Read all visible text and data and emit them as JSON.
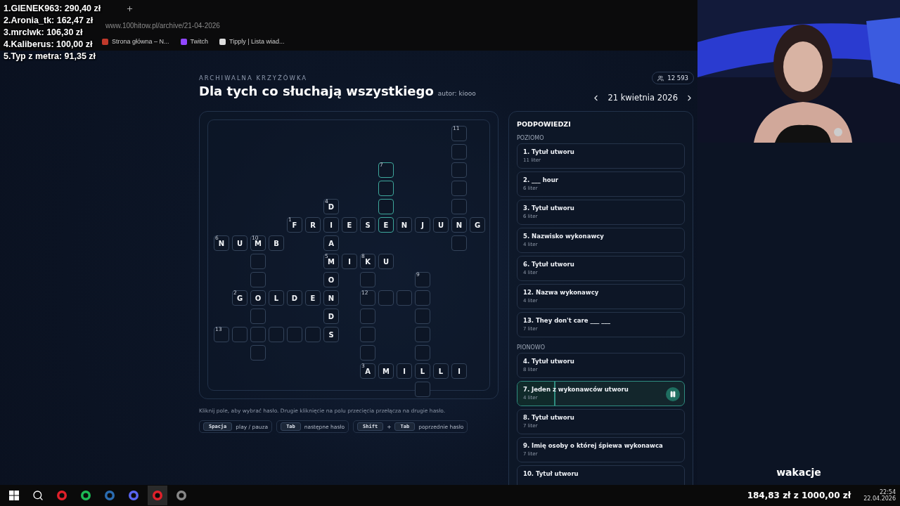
{
  "leaderboard": [
    "1.GIENEK963: 290,40 zł",
    "2.Aronia_tk: 162,47 zł",
    "3.mrclwk: 106,30 zł",
    "4.Kaliberus: 100,00 zł",
    "5.Typ z metra: 91,35 zł"
  ],
  "browser": {
    "address": "www.100hitow.pl/archive/21-04-2026",
    "bookmarks": [
      "Strona główna – N...",
      "Twitch",
      "Tipply | Lista wiad..."
    ]
  },
  "header": {
    "kicker": "ARCHIWALNA KRZYŻÓWKA",
    "title": "Dla tych co słuchają wszystkiego",
    "author": "autor: kiooo",
    "viewers": "12 593",
    "date": "21 kwietnia 2026"
  },
  "grid": [
    [
      {
        "kind": "block"
      },
      {
        "kind": "block"
      },
      {
        "kind": "block"
      },
      {
        "kind": "block"
      },
      {
        "kind": "block"
      },
      {
        "kind": "block"
      },
      {
        "kind": "block"
      },
      {
        "kind": "block"
      },
      {
        "kind": "block"
      },
      {
        "kind": "block"
      },
      {
        "kind": "block"
      },
      {
        "kind": "block"
      },
      {
        "kind": "block"
      },
      {
        "kind": "cell",
        "number": "11",
        "active": false
      },
      {
        "kind": "block"
      }
    ],
    [
      {
        "kind": "block"
      },
      {
        "kind": "block"
      },
      {
        "kind": "block"
      },
      {
        "kind": "block"
      },
      {
        "kind": "block"
      },
      {
        "kind": "block"
      },
      {
        "kind": "block"
      },
      {
        "kind": "block"
      },
      {
        "kind": "block"
      },
      {
        "kind": "block"
      },
      {
        "kind": "block"
      },
      {
        "kind": "block"
      },
      {
        "kind": "block"
      },
      {
        "kind": "cell",
        "active": false
      },
      {
        "kind": "block"
      }
    ],
    [
      {
        "kind": "block"
      },
      {
        "kind": "block"
      },
      {
        "kind": "block"
      },
      {
        "kind": "block"
      },
      {
        "kind": "block"
      },
      {
        "kind": "block"
      },
      {
        "kind": "block"
      },
      {
        "kind": "block"
      },
      {
        "kind": "block"
      },
      {
        "kind": "cell",
        "number": "7",
        "active": true
      },
      {
        "kind": "block"
      },
      {
        "kind": "block"
      },
      {
        "kind": "block"
      },
      {
        "kind": "cell",
        "active": false
      },
      {
        "kind": "block"
      }
    ],
    [
      {
        "kind": "block"
      },
      {
        "kind": "block"
      },
      {
        "kind": "block"
      },
      {
        "kind": "block"
      },
      {
        "kind": "block"
      },
      {
        "kind": "block"
      },
      {
        "kind": "block"
      },
      {
        "kind": "block"
      },
      {
        "kind": "block"
      },
      {
        "kind": "cell",
        "active": true
      },
      {
        "kind": "block"
      },
      {
        "kind": "block"
      },
      {
        "kind": "block"
      },
      {
        "kind": "cell",
        "active": false
      },
      {
        "kind": "block"
      }
    ],
    [
      {
        "kind": "block"
      },
      {
        "kind": "block"
      },
      {
        "kind": "block"
      },
      {
        "kind": "block"
      },
      {
        "kind": "block"
      },
      {
        "kind": "block"
      },
      {
        "kind": "cell",
        "letter": "D",
        "number": "4",
        "active": false
      },
      {
        "kind": "block"
      },
      {
        "kind": "block"
      },
      {
        "kind": "cell",
        "active": true
      },
      {
        "kind": "block"
      },
      {
        "kind": "block"
      },
      {
        "kind": "block"
      },
      {
        "kind": "cell",
        "active": false
      },
      {
        "kind": "block"
      }
    ],
    [
      {
        "kind": "block"
      },
      {
        "kind": "block"
      },
      {
        "kind": "block"
      },
      {
        "kind": "block"
      },
      {
        "kind": "cell",
        "letter": "F",
        "number": "1",
        "active": false
      },
      {
        "kind": "cell",
        "letter": "R",
        "active": false
      },
      {
        "kind": "cell",
        "letter": "I",
        "active": false
      },
      {
        "kind": "cell",
        "letter": "E",
        "active": false
      },
      {
        "kind": "cell",
        "letter": "S",
        "active": false
      },
      {
        "kind": "cell",
        "letter": "E",
        "active": true
      },
      {
        "kind": "cell",
        "letter": "N",
        "active": false
      },
      {
        "kind": "cell",
        "letter": "J",
        "active": false
      },
      {
        "kind": "cell",
        "letter": "U",
        "active": false
      },
      {
        "kind": "cell",
        "letter": "N",
        "active": false
      },
      {
        "kind": "cell",
        "letter": "G",
        "active": false
      }
    ],
    [
      {
        "kind": "cell",
        "letter": "N",
        "number": "6",
        "active": false
      },
      {
        "kind": "cell",
        "letter": "U",
        "active": false
      },
      {
        "kind": "cell",
        "letter": "M",
        "number": "10",
        "active": false
      },
      {
        "kind": "cell",
        "letter": "B",
        "active": false
      },
      {
        "kind": "block"
      },
      {
        "kind": "block"
      },
      {
        "kind": "cell",
        "letter": "A",
        "active": false
      },
      {
        "kind": "block"
      },
      {
        "kind": "block"
      },
      {
        "kind": "block"
      },
      {
        "kind": "block"
      },
      {
        "kind": "block"
      },
      {
        "kind": "block"
      },
      {
        "kind": "cell",
        "active": false
      },
      {
        "kind": "block"
      }
    ],
    [
      {
        "kind": "block"
      },
      {
        "kind": "block"
      },
      {
        "kind": "cell",
        "active": false
      },
      {
        "kind": "block"
      },
      {
        "kind": "block"
      },
      {
        "kind": "block"
      },
      {
        "kind": "cell",
        "letter": "M",
        "number": "5",
        "active": false
      },
      {
        "kind": "cell",
        "letter": "I",
        "active": false
      },
      {
        "kind": "cell",
        "letter": "K",
        "number": "8",
        "active": false
      },
      {
        "kind": "cell",
        "letter": "U",
        "active": false
      },
      {
        "kind": "block"
      },
      {
        "kind": "block"
      },
      {
        "kind": "block"
      },
      {
        "kind": "block"
      },
      {
        "kind": "block"
      }
    ],
    [
      {
        "kind": "block"
      },
      {
        "kind": "block"
      },
      {
        "kind": "cell",
        "active": false
      },
      {
        "kind": "block"
      },
      {
        "kind": "block"
      },
      {
        "kind": "block"
      },
      {
        "kind": "cell",
        "letter": "O",
        "active": false
      },
      {
        "kind": "block"
      },
      {
        "kind": "cell",
        "active": false
      },
      {
        "kind": "block"
      },
      {
        "kind": "block"
      },
      {
        "kind": "cell",
        "number": "9",
        "active": false
      },
      {
        "kind": "block"
      },
      {
        "kind": "block"
      },
      {
        "kind": "block"
      }
    ],
    [
      {
        "kind": "block"
      },
      {
        "kind": "cell",
        "letter": "G",
        "number": "2",
        "active": false
      },
      {
        "kind": "cell",
        "letter": "O",
        "active": false
      },
      {
        "kind": "cell",
        "letter": "L",
        "active": false
      },
      {
        "kind": "cell",
        "letter": "D",
        "active": false
      },
      {
        "kind": "cell",
        "letter": "E",
        "active": false
      },
      {
        "kind": "cell",
        "letter": "N",
        "active": false
      },
      {
        "kind": "block"
      },
      {
        "kind": "cell",
        "number": "12",
        "active": false
      },
      {
        "kind": "cell",
        "active": false
      },
      {
        "kind": "cell",
        "active": false
      },
      {
        "kind": "cell",
        "active": false
      },
      {
        "kind": "block"
      },
      {
        "kind": "block"
      },
      {
        "kind": "block"
      }
    ],
    [
      {
        "kind": "block"
      },
      {
        "kind": "block"
      },
      {
        "kind": "cell",
        "active": false
      },
      {
        "kind": "block"
      },
      {
        "kind": "block"
      },
      {
        "kind": "block"
      },
      {
        "kind": "cell",
        "letter": "D",
        "active": false
      },
      {
        "kind": "block"
      },
      {
        "kind": "cell",
        "active": false
      },
      {
        "kind": "block"
      },
      {
        "kind": "block"
      },
      {
        "kind": "cell",
        "active": false
      },
      {
        "kind": "block"
      },
      {
        "kind": "block"
      },
      {
        "kind": "block"
      }
    ],
    [
      {
        "kind": "cell",
        "number": "13",
        "active": false
      },
      {
        "kind": "cell",
        "active": false
      },
      {
        "kind": "cell",
        "active": false
      },
      {
        "kind": "cell",
        "active": false
      },
      {
        "kind": "cell",
        "active": false
      },
      {
        "kind": "cell",
        "active": false
      },
      {
        "kind": "cell",
        "letter": "S",
        "active": false
      },
      {
        "kind": "block"
      },
      {
        "kind": "cell",
        "active": false
      },
      {
        "kind": "block"
      },
      {
        "kind": "block"
      },
      {
        "kind": "cell",
        "active": false
      },
      {
        "kind": "block"
      },
      {
        "kind": "block"
      },
      {
        "kind": "block"
      }
    ],
    [
      {
        "kind": "block"
      },
      {
        "kind": "block"
      },
      {
        "kind": "cell",
        "active": false
      },
      {
        "kind": "block"
      },
      {
        "kind": "block"
      },
      {
        "kind": "block"
      },
      {
        "kind": "block"
      },
      {
        "kind": "block"
      },
      {
        "kind": "cell",
        "active": false
      },
      {
        "kind": "block"
      },
      {
        "kind": "block"
      },
      {
        "kind": "cell",
        "active": false
      },
      {
        "kind": "block"
      },
      {
        "kind": "block"
      },
      {
        "kind": "block"
      }
    ],
    [
      {
        "kind": "block"
      },
      {
        "kind": "block"
      },
      {
        "kind": "block"
      },
      {
        "kind": "block"
      },
      {
        "kind": "block"
      },
      {
        "kind": "block"
      },
      {
        "kind": "block"
      },
      {
        "kind": "block"
      },
      {
        "kind": "cell",
        "letter": "A",
        "number": "3",
        "active": false
      },
      {
        "kind": "cell",
        "letter": "M",
        "active": false
      },
      {
        "kind": "cell",
        "letter": "I",
        "active": false
      },
      {
        "kind": "cell",
        "letter": "L",
        "active": false
      },
      {
        "kind": "cell",
        "letter": "L",
        "active": false
      },
      {
        "kind": "cell",
        "letter": "I",
        "active": false
      },
      {
        "kind": "block"
      }
    ],
    [
      {
        "kind": "block"
      },
      {
        "kind": "block"
      },
      {
        "kind": "block"
      },
      {
        "kind": "block"
      },
      {
        "kind": "block"
      },
      {
        "kind": "block"
      },
      {
        "kind": "block"
      },
      {
        "kind": "block"
      },
      {
        "kind": "block"
      },
      {
        "kind": "block"
      },
      {
        "kind": "block"
      },
      {
        "kind": "cell",
        "active": false
      },
      {
        "kind": "block"
      },
      {
        "kind": "block"
      },
      {
        "kind": "block"
      }
    ]
  ],
  "hint": "Kliknij pole, aby wybrać hasło. Drugie kliknięcie na polu przecięcia przełącza na drugie hasło.",
  "shortcuts": [
    {
      "keys": [
        "Spacja"
      ],
      "action": "play / pauza"
    },
    {
      "keys": [
        "Tab"
      ],
      "action": "następne hasło"
    },
    {
      "keys": [
        "Shift",
        "Tab"
      ],
      "joiner": "+",
      "action": "poprzednie hasło"
    }
  ],
  "clues": {
    "title": "PODPOWIEDZI",
    "sections": [
      {
        "heading": "POZIOMO",
        "items": [
          {
            "text": "1. Tytuł utworu",
            "length": "11 liter",
            "selected": false
          },
          {
            "text": "2. ___ hour",
            "length": "6 liter",
            "selected": false
          },
          {
            "text": "3. Tytuł utworu",
            "length": "6 liter",
            "selected": false
          },
          {
            "text": "5. Nazwisko wykonawcy",
            "length": "4 liter",
            "selected": false
          },
          {
            "text": "6. Tytuł utworu",
            "length": "4 liter",
            "selected": false
          },
          {
            "text": "12. Nazwa wykonawcy",
            "length": "4 liter",
            "selected": false
          },
          {
            "text": "13. They don't care ___ ___",
            "length": "7 liter",
            "selected": false
          }
        ]
      },
      {
        "heading": "PIONOWO",
        "items": [
          {
            "text": "4. Tytuł utworu",
            "length": "8 liter",
            "selected": false
          },
          {
            "text": "7. Jeden z wykonawców utworu",
            "length": "4 liter",
            "selected": true,
            "level": 0.22
          },
          {
            "text": "8. Tytuł utworu",
            "length": "7 liter",
            "selected": false
          },
          {
            "text": "9. Imię osoby o której śpiewa wykonawca",
            "length": "7 liter",
            "selected": false
          },
          {
            "text": "10. Tytuł utworu",
            "selected": false
          }
        ]
      }
    ]
  },
  "stream": {
    "caption": "wakacje",
    "goal": "184,83 zł z 1000,00 zł"
  },
  "taskbar": {
    "time": "22:54",
    "date": "22.04.2026"
  }
}
